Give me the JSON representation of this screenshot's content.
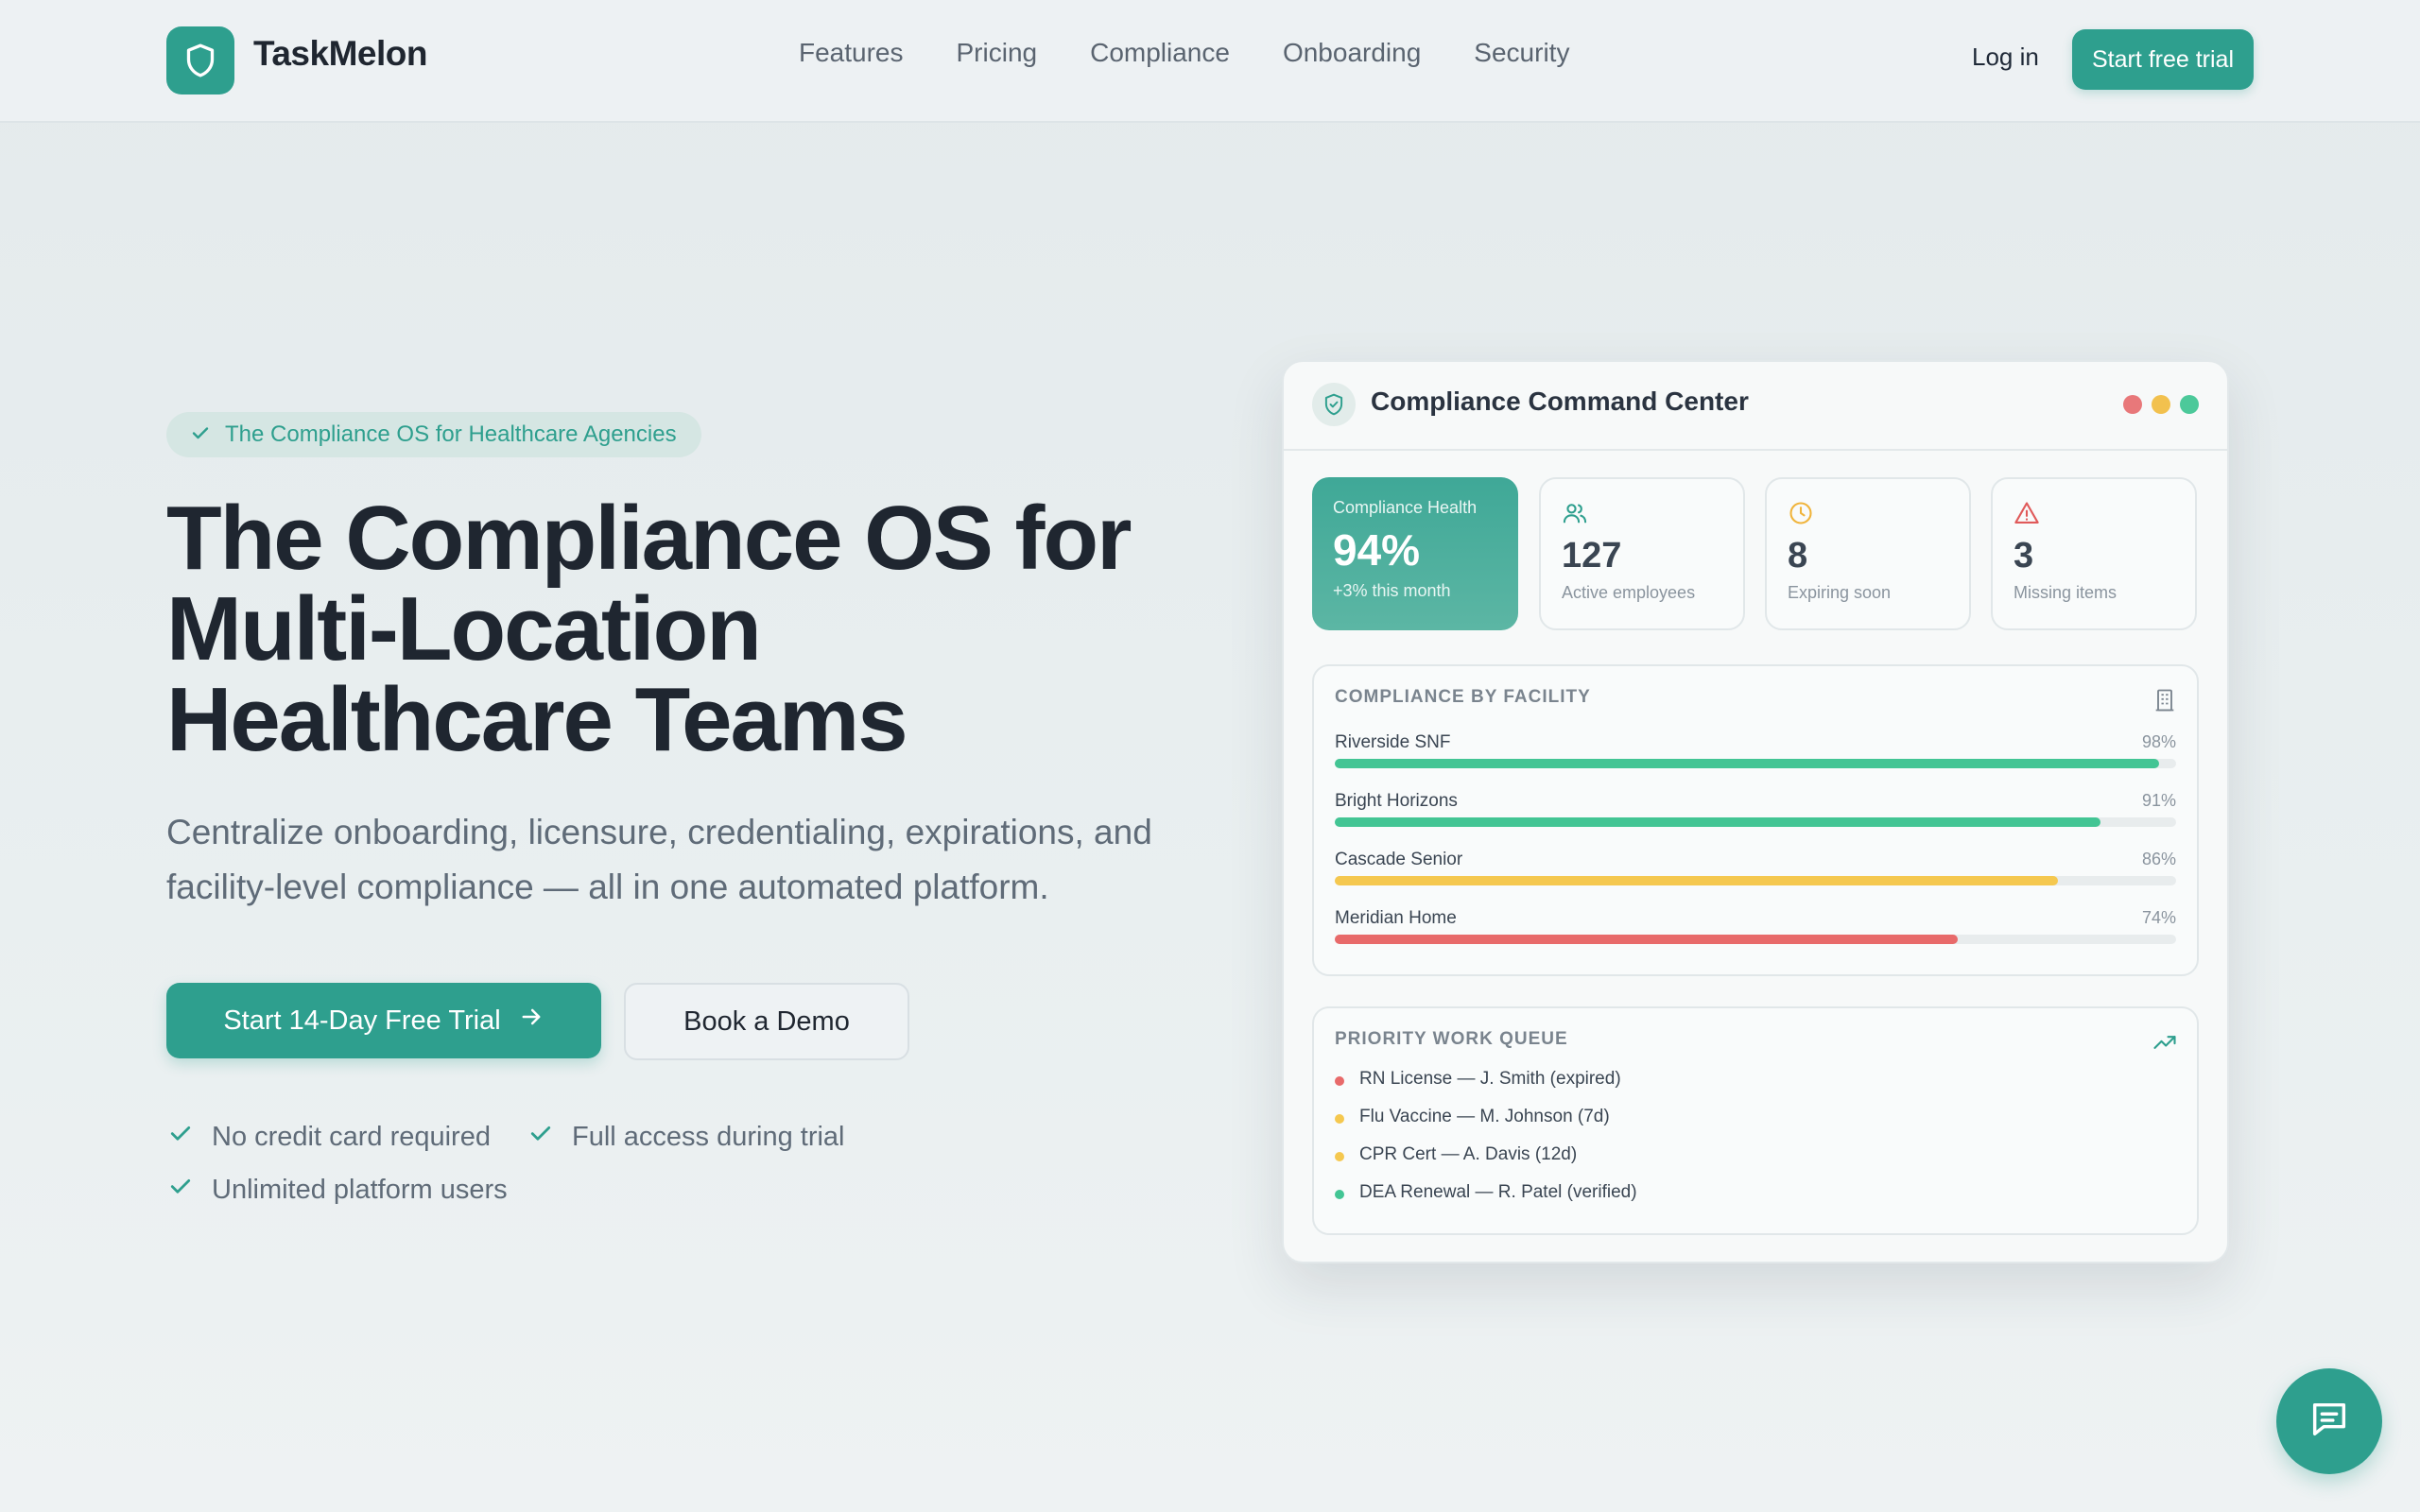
{
  "brand": {
    "name": "TaskMelon",
    "accent": "#2e9f8e"
  },
  "nav": {
    "items": [
      "Features",
      "Pricing",
      "Compliance",
      "Onboarding",
      "Security"
    ],
    "login": "Log in",
    "trial": "Start free trial"
  },
  "hero": {
    "badge": "The Compliance OS for Healthcare Agencies",
    "title_lines": [
      "The Compliance OS for",
      "Multi-Location",
      "Healthcare Teams"
    ],
    "subtitle": "Centralize onboarding, licensure, credentialing, expirations, and facility-level compliance — all in one automated platform.",
    "cta_primary": "Start 14-Day Free Trial",
    "cta_secondary": "Book a Demo",
    "perks": [
      "No credit card required",
      "Full access during trial",
      "Unlimited platform users"
    ]
  },
  "dashboard": {
    "title": "Compliance Command Center",
    "window_dots": [
      "#e8787a",
      "#f2c14e",
      "#4cc99a"
    ],
    "health": {
      "label": "Compliance Health",
      "value": "94%",
      "delta": "+3% this month"
    },
    "stats": [
      {
        "icon": "users-icon",
        "value": "127",
        "label": "Active employees",
        "color": "#2e9f8e"
      },
      {
        "icon": "clock-icon",
        "value": "8",
        "label": "Expiring soon",
        "color": "#f0b43c"
      },
      {
        "icon": "alert-triangle-icon",
        "value": "3",
        "label": "Missing items",
        "color": "#e05a5a"
      }
    ],
    "facility_heading": "COMPLIANCE BY FACILITY",
    "facilities": [
      {
        "name": "Riverside SNF",
        "pct_label": "98%",
        "pct": 98,
        "color": "#43c594"
      },
      {
        "name": "Bright Horizons",
        "pct_label": "91%",
        "pct": 91,
        "color": "#43c594"
      },
      {
        "name": "Cascade Senior",
        "pct_label": "86%",
        "pct": 86,
        "color": "#f5c84f"
      },
      {
        "name": "Meridian Home",
        "pct_label": "74%",
        "pct": 74,
        "color": "#e86a6a"
      }
    ],
    "queue_heading": "PRIORITY WORK QUEUE",
    "queue": [
      {
        "text": "RN License — J. Smith (expired)",
        "color": "#e86a6a"
      },
      {
        "text": "Flu Vaccine — M. Johnson (7d)",
        "color": "#f5c84f"
      },
      {
        "text": "CPR Cert — A. Davis (12d)",
        "color": "#f5c84f"
      },
      {
        "text": "DEA Renewal — R. Patel (verified)",
        "color": "#43c594"
      }
    ]
  }
}
